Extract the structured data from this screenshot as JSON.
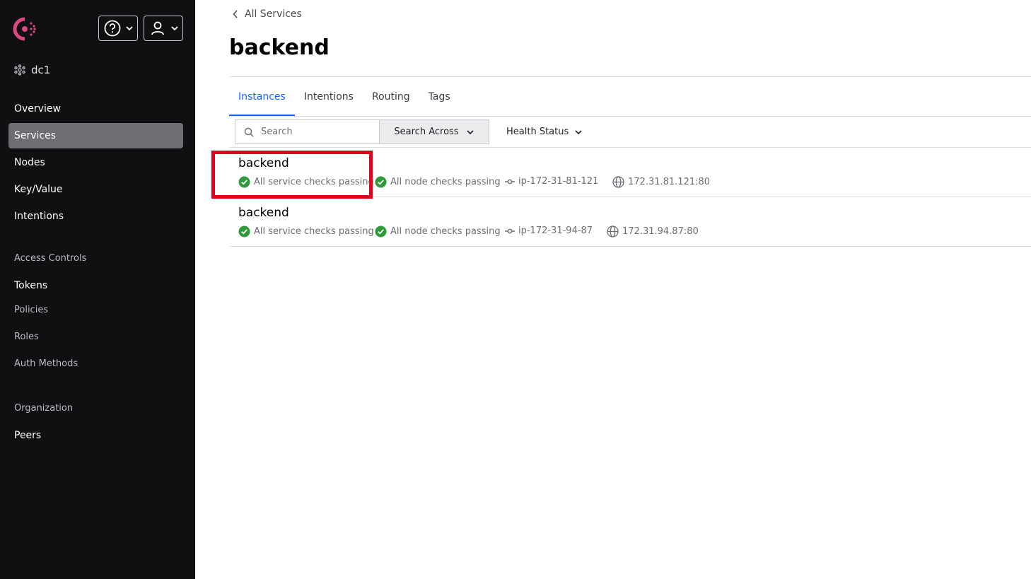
{
  "colors": {
    "sidebar_bg": "#101012",
    "active_nav": "#6d6e74",
    "accent": "#1563ff",
    "passing": "#2e9a3a",
    "highlight": "#e2001a",
    "brand": "#dc477d"
  },
  "sidebar": {
    "datacenter": "dc1",
    "nav": [
      "Overview",
      "Services",
      "Nodes",
      "Key/Value",
      "Intentions"
    ],
    "access_controls_heading": "Access Controls",
    "access": [
      "Tokens",
      "Policies",
      "Roles",
      "Auth Methods"
    ],
    "organization_heading": "Organization",
    "org": [
      "Peers"
    ]
  },
  "main": {
    "breadcrumb": "All Services",
    "title": "backend",
    "tabs": [
      "Instances",
      "Intentions",
      "Routing",
      "Tags"
    ],
    "search_placeholder": "Search",
    "search_across": "Search Across",
    "health_status": "Health Status",
    "instances": [
      {
        "name": "backend",
        "service_checks": "All service checks passing",
        "node_checks": "All node checks passing",
        "node": "ip-172-31-81-121",
        "address": "172.31.81.121:80"
      },
      {
        "name": "backend",
        "service_checks": "All service checks passing",
        "node_checks": "All node checks passing",
        "node": "ip-172-31-94-87",
        "address": "172.31.94.87:80"
      }
    ]
  }
}
